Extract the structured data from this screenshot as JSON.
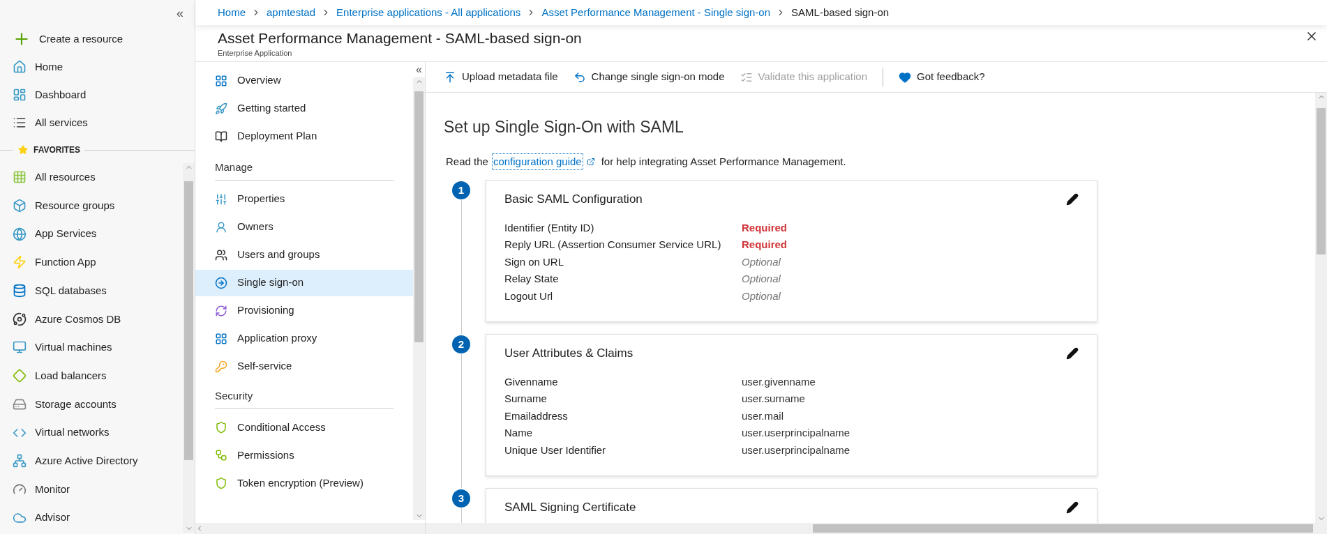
{
  "portal_nav": {
    "collapse": "«",
    "items": [
      {
        "label": "Create a resource"
      },
      {
        "label": "Home"
      },
      {
        "label": "Dashboard"
      },
      {
        "label": "All services"
      }
    ],
    "favorites_label": "FAVORITES",
    "favorites": [
      {
        "label": "All resources"
      },
      {
        "label": "Resource groups"
      },
      {
        "label": "App Services"
      },
      {
        "label": "Function App"
      },
      {
        "label": "SQL databases"
      },
      {
        "label": "Azure Cosmos DB"
      },
      {
        "label": "Virtual machines"
      },
      {
        "label": "Load balancers"
      },
      {
        "label": "Storage accounts"
      },
      {
        "label": "Virtual networks"
      },
      {
        "label": "Azure Active Directory"
      },
      {
        "label": "Monitor"
      },
      {
        "label": "Advisor"
      }
    ]
  },
  "breadcrumb": [
    "Home",
    "apmtestad",
    "Enterprise applications - All applications",
    "Asset Performance Management - Single sign-on",
    "SAML-based sign-on"
  ],
  "blade": {
    "title": "Asset Performance Management - SAML-based sign-on",
    "subtitle": "Enterprise Application"
  },
  "menu": {
    "collapse": "«",
    "top_items": [
      {
        "label": "Overview",
        "selected": false
      },
      {
        "label": "Getting started",
        "selected": false
      },
      {
        "label": "Deployment Plan",
        "selected": false
      }
    ],
    "sections": [
      {
        "heading": "Manage",
        "items": [
          {
            "label": "Properties",
            "selected": false
          },
          {
            "label": "Owners",
            "selected": false
          },
          {
            "label": "Users and groups",
            "selected": false
          },
          {
            "label": "Single sign-on",
            "selected": true
          },
          {
            "label": "Provisioning",
            "selected": false
          },
          {
            "label": "Application proxy",
            "selected": false
          },
          {
            "label": "Self-service",
            "selected": false
          }
        ]
      },
      {
        "heading": "Security",
        "items": [
          {
            "label": "Conditional Access",
            "selected": false
          },
          {
            "label": "Permissions",
            "selected": false
          },
          {
            "label": "Token encryption (Preview)",
            "selected": false
          }
        ]
      }
    ]
  },
  "toolbar": [
    {
      "label": "Upload metadata file",
      "disabled": false
    },
    {
      "label": "Change single sign-on mode",
      "disabled": false
    },
    {
      "label": "Validate this application",
      "disabled": true
    },
    {
      "label": "Got feedback?",
      "disabled": false
    }
  ],
  "content": {
    "heading": "Set up Single Sign-On with SAML",
    "intro": {
      "before": "Read the",
      "link": "configuration guide",
      "after": "for help integrating Asset Performance Management."
    },
    "steps": [
      {
        "number": "1",
        "title": "Basic SAML Configuration",
        "rows": [
          {
            "label": "Identifier (Entity ID)",
            "value": "Required",
            "kind": "required"
          },
          {
            "label": "Reply URL (Assertion Consumer Service URL)",
            "value": "Required",
            "kind": "required"
          },
          {
            "label": "Sign on URL",
            "value": "Optional",
            "kind": "optional"
          },
          {
            "label": "Relay State",
            "value": "Optional",
            "kind": "optional"
          },
          {
            "label": "Logout Url",
            "value": "Optional",
            "kind": "optional"
          }
        ]
      },
      {
        "number": "2",
        "title": "User Attributes & Claims",
        "rows": [
          {
            "label": "Givenname",
            "value": "user.givenname",
            "kind": "value"
          },
          {
            "label": "Surname",
            "value": "user.surname",
            "kind": "value"
          },
          {
            "label": "Emailaddress",
            "value": "user.mail",
            "kind": "value"
          },
          {
            "label": "Name",
            "value": "user.userprincipalname",
            "kind": "value"
          },
          {
            "label": "Unique User Identifier",
            "value": "user.userprincipalname",
            "kind": "value"
          }
        ]
      },
      {
        "number": "3",
        "title": "SAML Signing Certificate"
      }
    ]
  }
}
